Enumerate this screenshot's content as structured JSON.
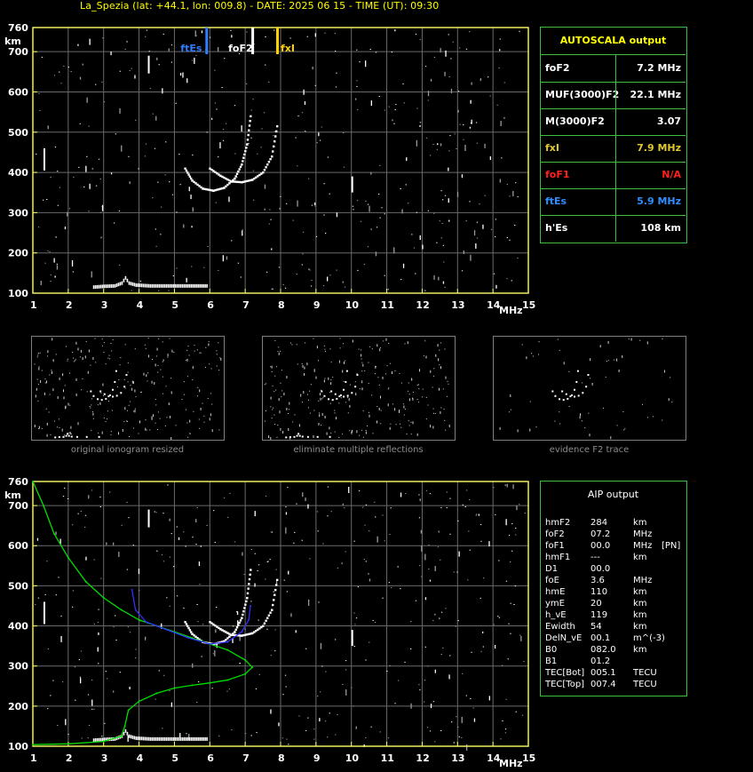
{
  "title": "La_Spezia (lat: +44.1, lon: 009.8) - DATE: 2025 06 15 - TIME (UT): 09:30",
  "colors": {
    "axis": "#ffff66",
    "grid": "#6a6a6a",
    "panel_border": "#3fbf3f",
    "profile_green": "#00dd00",
    "profile_blue": "#3030ff",
    "ftEs": "#2f7fff",
    "foF2": "#ffffff",
    "fxI": "#ffd200"
  },
  "chart_data": [
    {
      "type": "scatter",
      "id": "ionogram_top",
      "xlabel": "MHz",
      "ylabel": "km",
      "xlim": [
        1,
        15
      ],
      "ylim": [
        100,
        760
      ],
      "x_ticks": [
        "1",
        "2",
        "3",
        "4",
        "5",
        "6",
        "7",
        "8",
        "9",
        "10",
        "11",
        "12",
        "13",
        "14",
        "15"
      ],
      "y_ticks": [
        "100",
        "200",
        "300",
        "400",
        "500",
        "600",
        "700",
        "760"
      ],
      "markers": [
        {
          "label": "ftEs",
          "x": 5.9,
          "color": "#2f7fff"
        },
        {
          "label": "foF2",
          "x": 7.2,
          "color": "#ffffff"
        },
        {
          "label": "fxI",
          "x": 7.9,
          "color": "#ffd200"
        }
      ],
      "traces": {
        "es_layer": [
          [
            2.7,
            115
          ],
          [
            3.0,
            117
          ],
          [
            3.3,
            118
          ],
          [
            3.5,
            125
          ],
          [
            3.6,
            138
          ],
          [
            3.7,
            125
          ],
          [
            3.9,
            120
          ],
          [
            4.3,
            118
          ],
          [
            5.0,
            118
          ],
          [
            5.9,
            118
          ]
        ],
        "f2_ordinary": [
          [
            5.3,
            410
          ],
          [
            5.5,
            380
          ],
          [
            5.8,
            360
          ],
          [
            6.1,
            355
          ],
          [
            6.4,
            362
          ],
          [
            6.7,
            385
          ],
          [
            6.9,
            420
          ],
          [
            7.05,
            470
          ],
          [
            7.15,
            540
          ]
        ],
        "f2_extraordinary": [
          [
            6.0,
            410
          ],
          [
            6.3,
            392
          ],
          [
            6.6,
            378
          ],
          [
            6.9,
            376
          ],
          [
            7.2,
            382
          ],
          [
            7.5,
            400
          ],
          [
            7.75,
            440
          ],
          [
            7.9,
            515
          ]
        ]
      },
      "grid": true
    },
    {
      "type": "line",
      "id": "ionogram_bottom",
      "xlabel": "MHz",
      "ylabel": "km",
      "xlim": [
        1,
        15
      ],
      "ylim": [
        100,
        760
      ],
      "x_ticks": [
        "1",
        "2",
        "3",
        "4",
        "5",
        "6",
        "7",
        "8",
        "9",
        "10",
        "11",
        "12",
        "13",
        "14",
        "15"
      ],
      "y_ticks": [
        "100",
        "200",
        "300",
        "400",
        "500",
        "600",
        "700",
        "760"
      ],
      "series": [
        {
          "color": "#00dd00",
          "values": [
            [
              1.0,
              760
            ],
            [
              1.3,
              700
            ],
            [
              1.6,
              630
            ],
            [
              2.0,
              570
            ],
            [
              2.5,
              510
            ],
            [
              3.0,
              470
            ],
            [
              3.5,
              440
            ],
            [
              4.0,
              415
            ],
            [
              4.5,
              400
            ],
            [
              5.0,
              385
            ],
            [
              5.5,
              370
            ],
            [
              6.0,
              355
            ],
            [
              6.5,
              340
            ],
            [
              7.0,
              315
            ],
            [
              7.2,
              297
            ],
            [
              7.0,
              280
            ],
            [
              6.5,
              265
            ],
            [
              6.0,
              258
            ],
            [
              5.5,
              252
            ],
            [
              5.0,
              245
            ],
            [
              4.5,
              232
            ],
            [
              4.0,
              212
            ],
            [
              3.7,
              190
            ],
            [
              3.6,
              150
            ],
            [
              3.5,
              125
            ],
            [
              3.0,
              112
            ],
            [
              2.0,
              106
            ],
            [
              1.0,
              104
            ]
          ]
        },
        {
          "color": "#3030ff",
          "values": [
            [
              3.8,
              490
            ],
            [
              3.9,
              440
            ],
            [
              4.2,
              410
            ],
            [
              4.8,
              390
            ],
            [
              5.4,
              370
            ],
            [
              6.0,
              355
            ],
            [
              6.5,
              360
            ],
            [
              6.9,
              385
            ],
            [
              7.1,
              415
            ],
            [
              7.15,
              450
            ]
          ]
        }
      ],
      "grid": true
    }
  ],
  "autoscala": {
    "header": "AUTOSCALA output",
    "rows": [
      {
        "label": "foF2",
        "value": "7.2 MHz",
        "color": "#ffffff"
      },
      {
        "label": "MUF(3000)F2",
        "value": "22.1 MHz",
        "color": "#ffffff"
      },
      {
        "label": "M(3000)F2",
        "value": "3.07",
        "color": "#ffffff"
      },
      {
        "label": "fxI",
        "value": "7.9 MHz",
        "color": "#e0c830"
      },
      {
        "label": "foF1",
        "value": "N/A",
        "color": "#ff2020"
      },
      {
        "label": "ftEs",
        "value": "5.9 MHz",
        "color": "#2f8fff"
      },
      {
        "label": "h'Es",
        "value": "108     km",
        "color": "#ffffff"
      }
    ]
  },
  "thumbnails": [
    {
      "caption": "original ionogram resized"
    },
    {
      "caption": "eliminate multiple reflections"
    },
    {
      "caption": "evidence F2 trace"
    }
  ],
  "aip": {
    "header": "AIP output",
    "rows": [
      {
        "k": "hmF2",
        "v": "284",
        "u": "km",
        "x": ""
      },
      {
        "k": "foF2",
        "v": "07.2",
        "u": "MHz",
        "x": ""
      },
      {
        "k": "foF1",
        "v": "00.0",
        "u": "MHz",
        "x": "[PN]"
      },
      {
        "k": "hmF1",
        "v": "---",
        "u": "km",
        "x": ""
      },
      {
        "k": "D1",
        "v": "00.0",
        "u": "",
        "x": ""
      },
      {
        "k": "foE",
        "v": "3.6",
        "u": "MHz",
        "x": ""
      },
      {
        "k": "hmE",
        "v": "110",
        "u": "km",
        "x": ""
      },
      {
        "k": "ymE",
        "v": "20",
        "u": "km",
        "x": ""
      },
      {
        "k": "h_vE",
        "v": "119",
        "u": "km",
        "x": ""
      },
      {
        "k": "Ewidth",
        "v": "54",
        "u": "km",
        "x": ""
      },
      {
        "k": "DelN_vE",
        "v": "00.1",
        "u": "m^(-3)",
        "x": ""
      },
      {
        "k": "B0",
        "v": "082.0",
        "u": "km",
        "x": ""
      },
      {
        "k": "B1",
        "v": "01.2",
        "u": "",
        "x": ""
      },
      {
        "k": "TEC[Bot]",
        "v": "005.1",
        "u": "TECU",
        "x": ""
      },
      {
        "k": "TEC[Top]",
        "v": "007.4",
        "u": "TECU",
        "x": ""
      }
    ]
  }
}
